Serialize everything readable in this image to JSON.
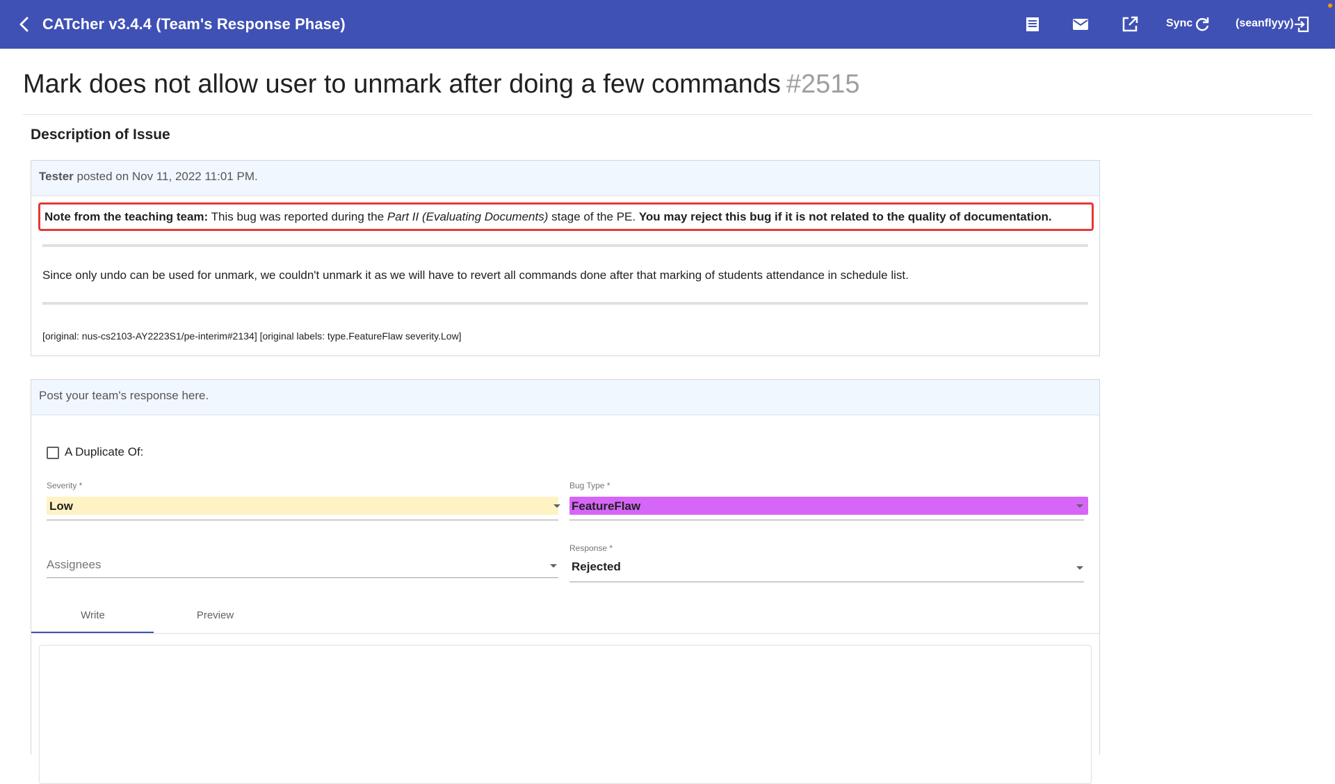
{
  "header": {
    "app_title": "CATcher v3.4.4  (Team's Response Phase)",
    "sync_label": "Sync",
    "user_label": "(seanflyyy)",
    "icons": [
      "back-arrow-icon",
      "document-icon",
      "mail-icon",
      "open-external-icon",
      "refresh-icon",
      "logout-icon"
    ]
  },
  "issue": {
    "title": "Mark does not allow user to unmark after doing a few commands",
    "number": "#2515"
  },
  "description": {
    "heading": "Description of Issue",
    "author": "Tester",
    "posted": "posted on Nov 11, 2022 11:01 PM.",
    "note_prefix": "Note from the teaching team:",
    "note_middle": "This bug was reported during the",
    "note_stage": "Part II (Evaluating Documents)",
    "note_suffix": "stage of the PE.",
    "note_bold": "You may reject this bug if it is not related to the quality of documentation.",
    "body": "Since only undo can be used for unmark, we couldn't unmark it as we will have to revert all commands done after that marking of students attendance in schedule list.",
    "original": "[original: nus-cs2103-AY2223S1/pe-interim#2134] [original labels: type.FeatureFlaw severity.Low]"
  },
  "response": {
    "header": "Post your team's response here.",
    "duplicate_label": "A Duplicate Of:",
    "severity_label": "Severity *",
    "severity_value": "Low",
    "bugtype_label": "Bug Type *",
    "bugtype_value": "FeatureFlaw",
    "assignees_placeholder": "Assignees",
    "response_label": "Response *",
    "response_value": "Rejected",
    "tabs": [
      "Write",
      "Preview"
    ]
  },
  "colors": {
    "toolbar": "#3f51b5",
    "severity_low": "#fff3c4",
    "featureflaw": "#d666f7",
    "note_border": "#e53935"
  }
}
